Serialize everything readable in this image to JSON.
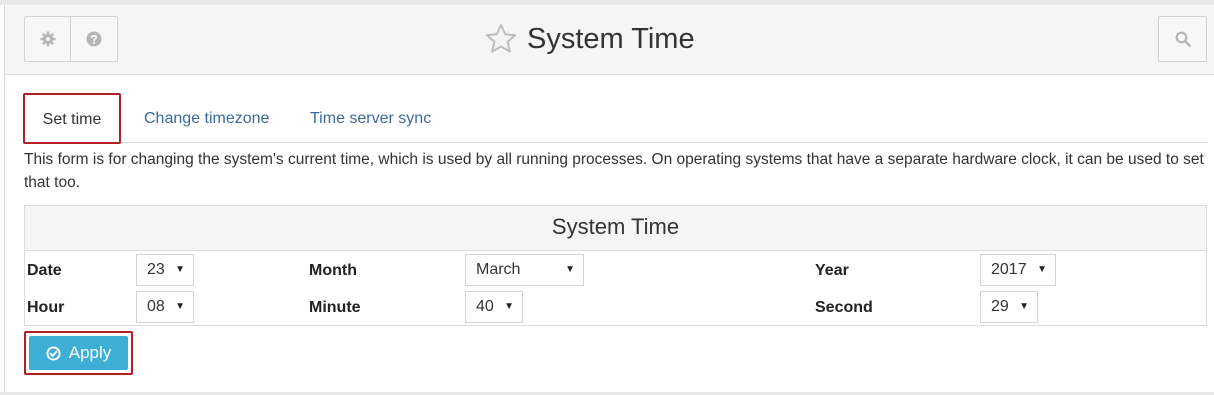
{
  "header": {
    "title": "System Time",
    "icons": [
      "gear-icon",
      "question-icon",
      "star-icon",
      "search-icon"
    ]
  },
  "tabs": [
    {
      "label": "Set time",
      "active": true
    },
    {
      "label": "Change timezone",
      "active": false
    },
    {
      "label": "Time server sync",
      "active": false
    }
  ],
  "intro": "This form is for changing the system's current time, which is used by all running processes. On operating systems that have a separate hardware clock, it can be used to set that too.",
  "panel": {
    "title": "System Time",
    "fields": {
      "date": {
        "label": "Date",
        "value": "23"
      },
      "month": {
        "label": "Month",
        "value": "March"
      },
      "year": {
        "label": "Year",
        "value": "2017"
      },
      "hour": {
        "label": "Hour",
        "value": "08"
      },
      "minute": {
        "label": "Minute",
        "value": "40"
      },
      "second": {
        "label": "Second",
        "value": "29"
      }
    }
  },
  "apply": {
    "label": "Apply"
  },
  "colors": {
    "accent": "#3dafd6",
    "highlight_border": "#b11f24",
    "link": "#3a6b9f"
  }
}
